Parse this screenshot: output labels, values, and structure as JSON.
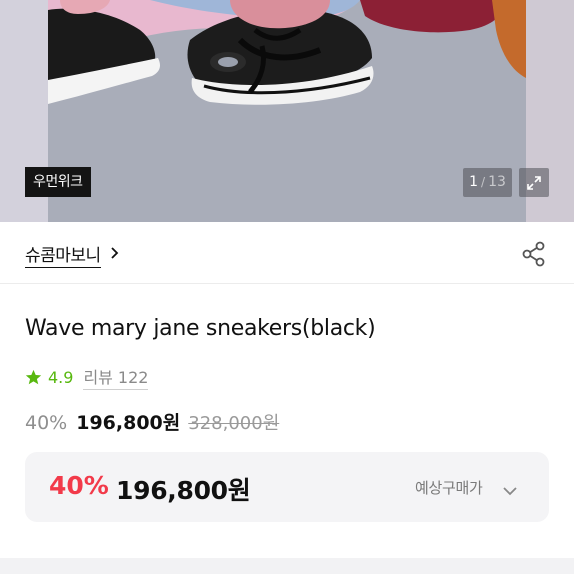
{
  "hero": {
    "brand_tag": "우먼위크",
    "page_current": "1",
    "page_separator": "/",
    "page_total": "13",
    "expand_icon": "expand-icon"
  },
  "brand": {
    "name": "슈콤마보니",
    "chevron_icon": "chevron-right-icon",
    "share_icon": "share-icon"
  },
  "product": {
    "title": "Wave mary jane sneakers(black)",
    "rating": "4.9",
    "review_label": "리뷰",
    "review_count": "122",
    "discount": "40%",
    "sale_price": "196,800원",
    "original_price": "328,000원"
  },
  "expected_price": {
    "discount": "40%",
    "price": "196,800원",
    "label": "예상구매가"
  },
  "colors": {
    "rating_green": "#58b80f",
    "discount_red": "#f23a4a",
    "box_bg": "#f4f4f6"
  }
}
